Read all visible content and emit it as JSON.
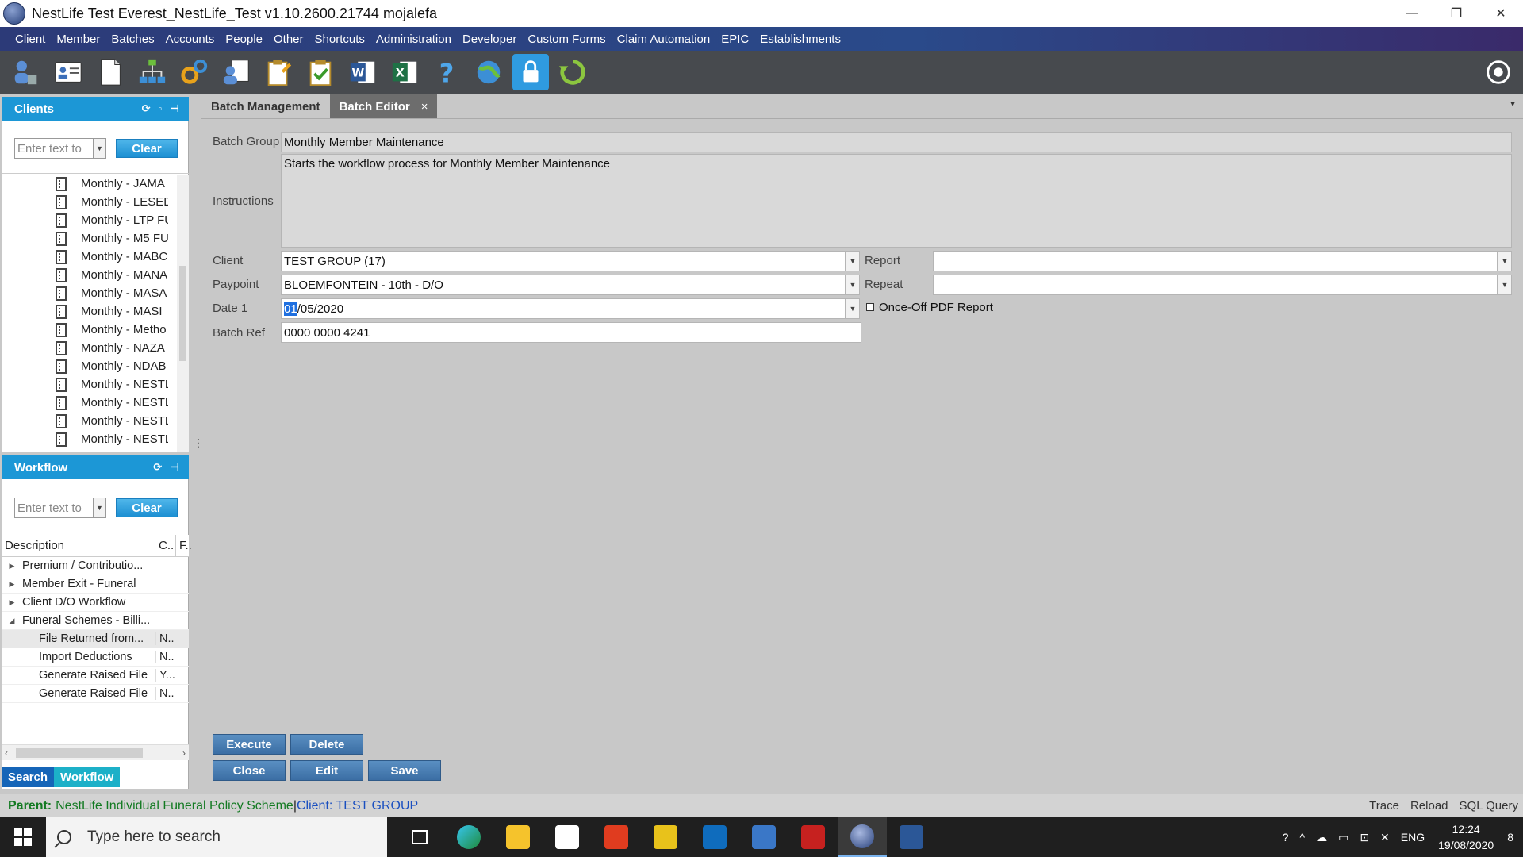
{
  "window": {
    "title": "NestLife Test Everest_NestLife_Test v1.10.2600.21744 mojalefa",
    "minimize": "—",
    "restore": "❐",
    "close": "✕"
  },
  "menu": [
    "Client",
    "Member",
    "Batches",
    "Accounts",
    "People",
    "Other",
    "Shortcuts",
    "Administration",
    "Developer",
    "Custom Forms",
    "Claim Automation",
    "EPIC",
    "Establishments"
  ],
  "clients_panel": {
    "title": "Clients",
    "search_placeholder": "Enter text to",
    "clear_label": "Clear",
    "items": [
      "Monthly - JAMA",
      "Monthly - LESED",
      "Monthly - LTP FU",
      "Monthly - M5 FU",
      "Monthly - MABC",
      "Monthly - MANA",
      "Monthly - MASA",
      "Monthly - MASI",
      "Monthly - Metho",
      "Monthly - NAZA",
      "Monthly - NDAB",
      "Monthly - NESTL",
      "Monthly - NESTL",
      "Monthly - NESTL",
      "Monthly - NESTL"
    ]
  },
  "workflow_panel": {
    "title": "Workflow",
    "search_placeholder": "Enter text to",
    "clear_label": "Clear",
    "columns": [
      "Description",
      "C..",
      "F.."
    ],
    "groups": [
      {
        "label": "Premium / Contributio...",
        "expanded": false
      },
      {
        "label": "Member Exit - Funeral",
        "expanded": false
      },
      {
        "label": "Client D/O Workflow",
        "expanded": false
      },
      {
        "label": "Funeral Schemes - Billi...",
        "expanded": true
      }
    ],
    "children": [
      {
        "label": "File Returned from...",
        "c": "N.."
      },
      {
        "label": "Import Deductions",
        "c": "N.."
      },
      {
        "label": "Generate Raised File",
        "c": "Y..."
      },
      {
        "label": "Generate Raised File",
        "c": "N.."
      }
    ],
    "bottom_tabs": [
      "Search",
      "Workflow"
    ]
  },
  "tabs": [
    {
      "label": "Batch Management",
      "active": false
    },
    {
      "label": "Batch Editor",
      "active": true,
      "close": "×"
    }
  ],
  "form": {
    "batch_group_label": "Batch Group",
    "batch_group_value": "Monthly Member Maintenance",
    "instructions_label": "Instructions",
    "instructions_value": "Starts the workflow process for Monthly Member Maintenance",
    "client_label": "Client",
    "client_value": "TEST GROUP (17)",
    "paypoint_label": "Paypoint",
    "paypoint_value": "BLOEMFONTEIN - 10th - D/O",
    "date1_label": "Date 1",
    "date1_selected": "01",
    "date1_rest": "/05/2020",
    "batchref_label": "Batch Ref",
    "batchref_value": "0000 0000 4241",
    "report_label": "Report",
    "report_value": "",
    "repeat_label": "Repeat",
    "repeat_value": "",
    "onceoff_label": "Once-Off PDF Report"
  },
  "actions": {
    "execute": "Execute",
    "delete": "Delete",
    "close": "Close",
    "edit": "Edit",
    "save": "Save"
  },
  "statusbar": {
    "parent_label": "Parent:",
    "parent_value": "NestLife Individual Funeral Policy Scheme",
    "separator": "|",
    "client_text": "Client: TEST GROUP",
    "links": [
      "Trace",
      "Reload",
      "SQL Query"
    ]
  },
  "taskbar": {
    "search_placeholder": "Type here to search",
    "lang": "ENG",
    "time": "12:24",
    "date": "19/08/2020",
    "notifications": "8"
  },
  "colors": {
    "accent": "#1c97d6",
    "action_button": "#3b6ea4",
    "status_green": "#137a22",
    "status_blue": "#1a4fc0"
  }
}
